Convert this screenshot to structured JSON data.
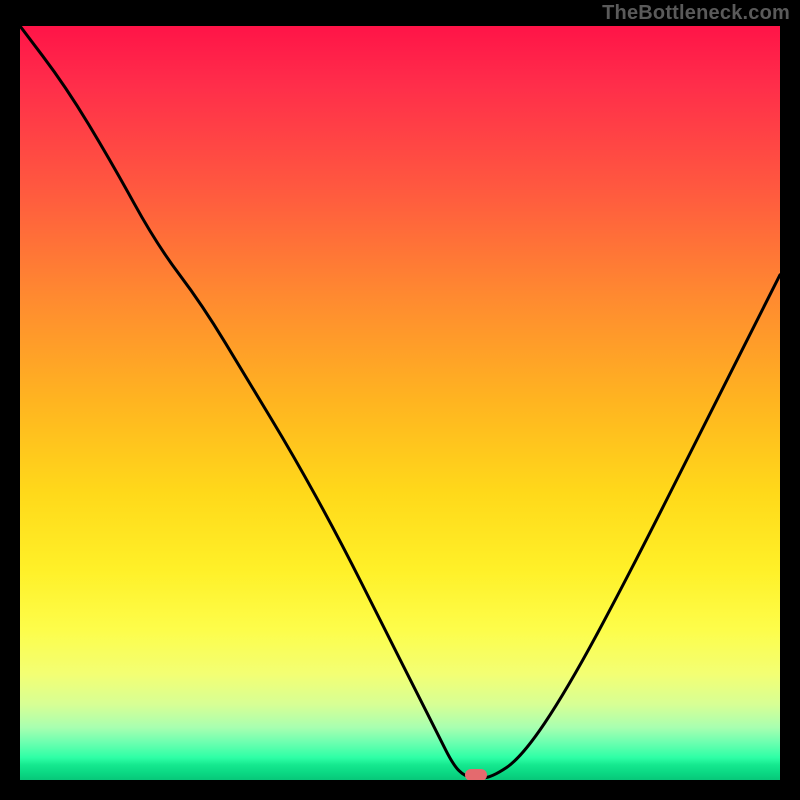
{
  "watermark": "TheBottleneck.com",
  "chart_data": {
    "type": "line",
    "title": "",
    "xlabel": "",
    "ylabel": "",
    "x_range": [
      0,
      100
    ],
    "y_range": [
      0,
      100
    ],
    "series": [
      {
        "name": "curve",
        "x": [
          0,
          6,
          12,
          18,
          24,
          30,
          36,
          42,
          48,
          52,
          55,
          57,
          58.5,
          60,
          62,
          66,
          72,
          80,
          90,
          100
        ],
        "y": [
          100,
          92,
          82,
          71,
          63,
          53,
          43,
          32,
          20,
          12,
          6,
          2,
          0.5,
          0.3,
          0.3,
          3,
          12,
          27,
          47,
          67
        ]
      }
    ],
    "marker": {
      "x": 60,
      "y": 0.6,
      "label": ""
    },
    "colors": {
      "curve": "#000000",
      "marker": "#e46a6e",
      "background_top": "#ff1448",
      "background_bottom": "#07c779"
    }
  }
}
